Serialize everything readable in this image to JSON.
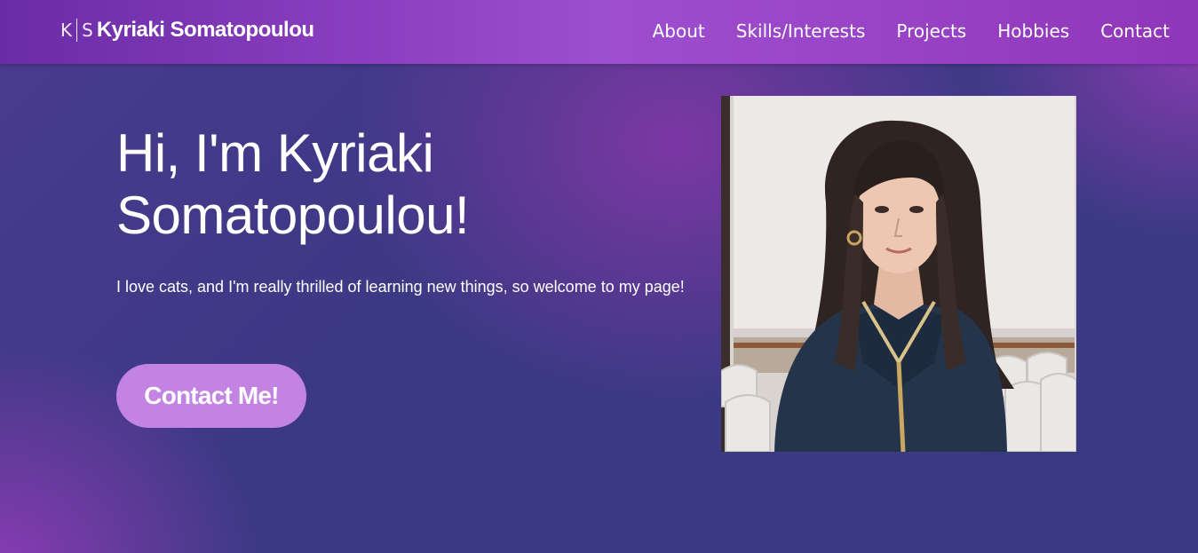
{
  "header": {
    "logo_letters": [
      "K",
      "S"
    ],
    "brand_name": "Kyriaki Somatopoulou",
    "nav": [
      {
        "label": "About"
      },
      {
        "label": "Skills/Interests"
      },
      {
        "label": "Projects"
      },
      {
        "label": "Hobbies"
      },
      {
        "label": "Contact"
      }
    ]
  },
  "hero": {
    "title": "Hi, I'm Kyriaki Somatopoulou!",
    "text": "I love cats, and I'm really thrilled of learning new things, so welcome to my page!",
    "button_label": "Contact Me!",
    "photo_icon": "profile-photo"
  },
  "colors": {
    "nav_bg": "#8a3ebf",
    "page_bg": "#3b3682",
    "button_bg": "#c283e3",
    "text": "#ffffff"
  }
}
